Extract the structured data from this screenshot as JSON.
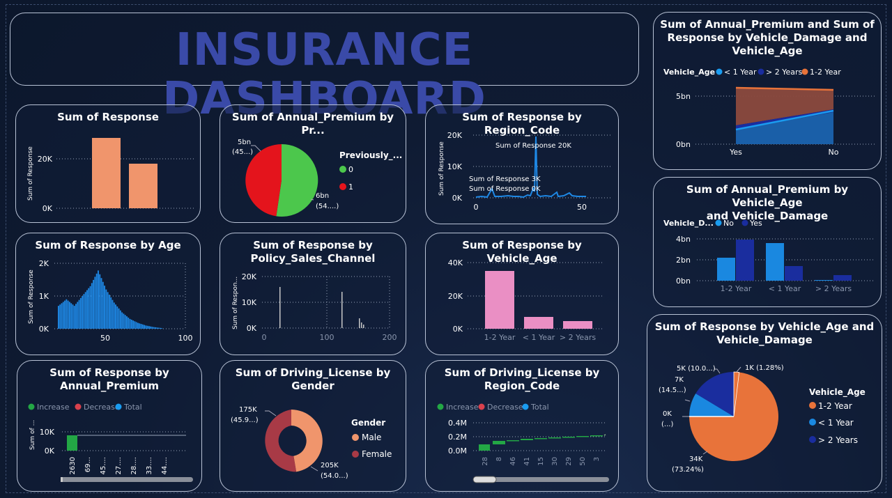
{
  "title": "INSURANCE DASHBOARD",
  "colors": {
    "salmon": "#f0956c",
    "pie_green": "#4cc74c",
    "pie_red": "#e4141c",
    "blue": "#1e88e5",
    "bright_blue": "#1a9cf0",
    "pink": "#ea8fc4",
    "orange": "#e8733a",
    "navy": "#1a2d9e",
    "maroon": "#a83a46",
    "waterfall_green": "#23a745",
    "text_muted": "#8a96ad"
  },
  "charts": {
    "response": {
      "title": "Sum of Response",
      "ylabel": "Sum of Response",
      "ticks": [
        "20K",
        "0K"
      ]
    },
    "premium_prev": {
      "title": "Sum of Annual_Premium by Pr...",
      "legend_title": "Previously_...",
      "legend": [
        "0",
        "1"
      ],
      "label_a_1": "5bn",
      "label_a_2": "(45...)",
      "label_b_1": "6bn",
      "label_b_2": "(54....)"
    },
    "region": {
      "title": "Sum of Response by Region_Code",
      "ylabel": "Sum of Response",
      "yticks": [
        "20K",
        "10K",
        "0K"
      ],
      "xticks": [
        "0",
        "50"
      ],
      "ann1": "Sum of Response 20K",
      "ann2": "Sum of Response 3K",
      "ann3": "Sum of Response 0K"
    },
    "age": {
      "title": "Sum of Response by Age",
      "ylabel": "Sum of Response",
      "yticks": [
        "2K",
        "1K",
        "0K"
      ],
      "xticks": [
        "50",
        "100"
      ]
    },
    "channel": {
      "title_1": "Sum of Response by",
      "title_2": "Policy_Sales_Channel",
      "ylabel": "Sum of Respon...",
      "yticks": [
        "20K",
        "10K",
        "0K"
      ],
      "xticks": [
        "0",
        "100",
        "200"
      ]
    },
    "vehage": {
      "title": "Sum of Response by Vehicle_Age",
      "yticks": [
        "40K",
        "20K",
        "0K"
      ]
    },
    "ap_waterfall": {
      "title_1": "Sum of Response by",
      "title_2": "Annual_Premium",
      "legend": [
        "Increase",
        "Decrease",
        "Total"
      ],
      "ylabel": "Sum of ...",
      "yticks": [
        "10K",
        "0K"
      ],
      "xticks": [
        "2630",
        "69...",
        "45....",
        "27....",
        "28....",
        "33....",
        "44...."
      ]
    },
    "dl_gender": {
      "title_1": "Sum of Driving_License by",
      "title_2": "Gender",
      "legend_title": "Gender",
      "legend": [
        "Male",
        "Female"
      ],
      "label_a_1": "175K",
      "label_a_2": "(45.9...)",
      "label_b_1": "205K",
      "label_b_2": "(54.0...)"
    },
    "dl_region": {
      "title_1": "Sum of Driving_License by",
      "title_2": "Region_Code",
      "legend": [
        "Increase",
        "Decrease",
        "Total"
      ],
      "yticks": [
        "0.4M",
        "0.2M",
        "0.0M"
      ],
      "xticks": [
        "28",
        "8",
        "46",
        "41",
        "15",
        "30",
        "29",
        "50",
        "3"
      ]
    },
    "ap_damage_age": {
      "title_1": "Sum of Annual_Premium and Sum of",
      "title_2": "Response by Vehicle_Damage and",
      "title_3": "Vehicle_Age",
      "legend_title": "Vehicle_Age",
      "legend": [
        "< 1 Year",
        "> 2 Years",
        "1-2 Year"
      ],
      "yticks": [
        "5bn",
        "0bn"
      ],
      "xticks": [
        "Yes",
        "No"
      ]
    },
    "ap_age_damage": {
      "title_1": "Sum of Annual_Premium by Vehicle_Age",
      "title_2": "and Vehicle_Damage",
      "legend_title": "Vehicle_D...",
      "legend": [
        "No",
        "Yes"
      ],
      "yticks": [
        "4bn",
        "2bn",
        "0bn"
      ]
    },
    "resp_age_damage": {
      "title_1": "Sum of Response by Vehicle_Age and",
      "title_2": "Vehicle_Damage",
      "legend_title": "Vehicle_Age",
      "legend": [
        "1-2 Year",
        "< 1 Year",
        "> 2 Years"
      ],
      "l1": "5K (10.0...)",
      "l2": "1K (1.28%)",
      "l3a": "7K",
      "l3b": "(14.5...)",
      "l4a": "0K",
      "l4b": "(...)",
      "l5a": "34K",
      "l5b": "(73.24%)"
    }
  },
  "chart_data": [
    {
      "type": "bar",
      "title": "Sum of Response",
      "ylabel": "Sum of Response",
      "categories": [
        "",
        ""
      ],
      "values": [
        28500,
        18000
      ],
      "ylim": [
        0,
        30000
      ]
    },
    {
      "type": "pie",
      "title": "Sum of Annual_Premium by Pr...",
      "categories": [
        "0",
        "1"
      ],
      "values": [
        6,
        5
      ]
    },
    {
      "type": "line",
      "title": "Sum of Response by Region_Code",
      "xlabel": "",
      "ylabel": "Sum of Response",
      "x": [
        0,
        8,
        11,
        15,
        20,
        25,
        28,
        30,
        35,
        40,
        41,
        45,
        46,
        50,
        52
      ],
      "values": [
        200,
        500,
        2800,
        600,
        400,
        500,
        3000,
        20000,
        800,
        600,
        1500,
        400,
        1000,
        300,
        200
      ],
      "ylim": [
        0,
        20000
      ]
    },
    {
      "type": "bar",
      "title": "Sum of Response by Age",
      "ylabel": "Sum of Response",
      "x": [
        20,
        25,
        30,
        35,
        40,
        45,
        50,
        55,
        60,
        65,
        70,
        75,
        80,
        85
      ],
      "values": [
        700,
        900,
        700,
        1000,
        1300,
        1780,
        1200,
        800,
        500,
        300,
        180,
        100,
        50,
        20
      ],
      "ylim": [
        0,
        2000
      ]
    },
    {
      "type": "bar",
      "title": "Sum of Response by Policy_Sales_Channel",
      "ylabel": "Sum of Respon...",
      "x": [
        26,
        124,
        152,
        156
      ],
      "values": [
        15800,
        13500,
        3500,
        1500
      ],
      "ylim": [
        0,
        20000
      ]
    },
    {
      "type": "bar",
      "title": "Sum of Response by Vehicle_Age",
      "categories": [
        "1-2 Year",
        "< 1 Year",
        "> 2 Years"
      ],
      "values": [
        34800,
        7200,
        4700
      ],
      "ylim": [
        0,
        40000
      ]
    },
    {
      "type": "bar",
      "title": "Sum of Response by Annual_Premium",
      "categories": [
        "2630",
        "69...",
        "45....",
        "27....",
        "28....",
        "33....",
        "44...."
      ],
      "values": [
        8000,
        0,
        0,
        0,
        0,
        0,
        0
      ],
      "ylim": [
        0,
        15000
      ]
    },
    {
      "type": "pie",
      "title": "Sum of Driving_License by Gender",
      "categories": [
        "Male",
        "Female"
      ],
      "values": [
        205000,
        175000
      ]
    },
    {
      "type": "bar",
      "title": "Sum of Driving_License by Region_Code",
      "categories": [
        "28",
        "8",
        "46",
        "41",
        "15",
        "30",
        "29",
        "50",
        "3"
      ],
      "values": [
        0.09,
        0.14,
        0.15,
        0.17,
        0.18,
        0.19,
        0.2,
        0.21,
        0.22
      ],
      "ylim": [
        0,
        0.4
      ]
    },
    {
      "type": "area",
      "title": "Sum of Annual_Premium and Sum of Response by Vehicle_Damage and Vehicle_Age",
      "categories": [
        "Yes",
        "No"
      ],
      "series": [
        {
          "name": "< 1 Year",
          "values": [
            1.3,
            3.3
          ]
        },
        {
          "name": "> 2 Years",
          "values": [
            0.4,
            0.3
          ]
        },
        {
          "name": "1-2 Year",
          "values": [
            4.2,
            1.9
          ]
        }
      ],
      "ylim": [
        0,
        6
      ]
    },
    {
      "type": "bar",
      "title": "Sum of Annual_Premium by Vehicle_Age and Vehicle_Damage",
      "categories": [
        "1-2 Year",
        "< 1 Year",
        "> 2 Years"
      ],
      "series": [
        {
          "name": "No",
          "values": [
            2.2,
            3.6,
            0.05
          ]
        },
        {
          "name": "Yes",
          "values": [
            3.9,
            1.4,
            0.55
          ]
        }
      ],
      "ylim": [
        0,
        4.5
      ]
    },
    {
      "type": "pie",
      "title": "Sum of Response by Vehicle_Age and Vehicle_Damage",
      "categories": [
        "1-2 Year",
        "< 1 Year",
        "> 2 Years",
        "1-2 Year",
        ""
      ],
      "values": [
        34,
        7,
        5,
        0.6,
        0.01
      ]
    }
  ]
}
